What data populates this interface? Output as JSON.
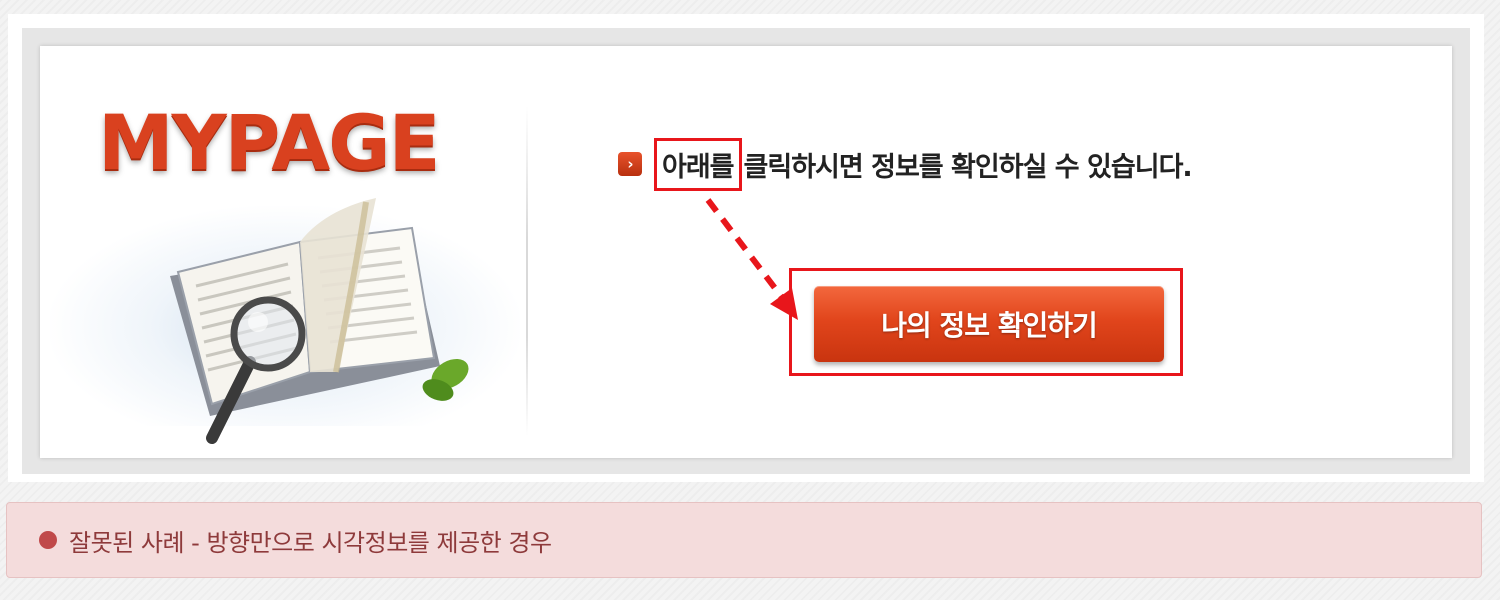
{
  "banner": {
    "logo_text": "MYPAGE",
    "instruction": {
      "highlighted_word": "아래를",
      "rest": "클릭하시면 정보를 확인하실 수 있습니다."
    },
    "button_label": "나의 정보 확인하기"
  },
  "caption": {
    "text": "잘못된 사례 - 방향만으로 시각정보를 제공한 경우"
  },
  "icons": {
    "instruction_bullet": "chevron-right-icon",
    "caption_bullet": "circle-bullet-icon",
    "illustration": "book-magnifier-icon",
    "pointer": "dashed-arrow-icon"
  },
  "colors": {
    "brand_orange": "#e1451c",
    "highlight_red": "#e8161b",
    "caption_bg": "#f4dcdc",
    "caption_text": "#8e3a3b"
  }
}
